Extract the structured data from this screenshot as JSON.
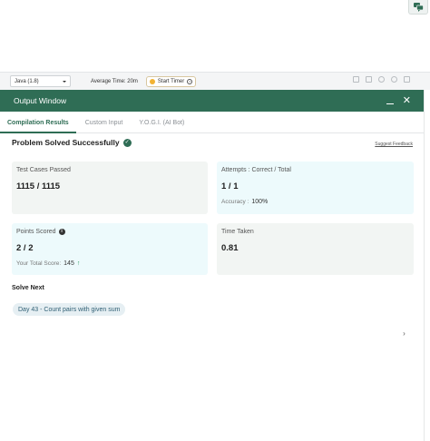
{
  "toolbar": {
    "language": "Java (1.8)",
    "avg_time": "Average Time: 20m",
    "start_timer": "Start Timer"
  },
  "output_window": {
    "title": "Output Window",
    "tabs": [
      {
        "label": "Compilation Results",
        "active": true
      },
      {
        "label": "Custom Input",
        "active": false
      },
      {
        "label": "Y.O.G.I. (AI Bot)",
        "active": false
      }
    ]
  },
  "result": {
    "status": "Problem Solved Successfully",
    "feedback_link": "Suggest Feedback"
  },
  "cards": {
    "test_cases": {
      "label": "Test Cases Passed",
      "value": "1115 / 1115"
    },
    "attempts": {
      "label": "Attempts : Correct / Total",
      "value": "1 / 1",
      "accuracy_label": "Accuracy :",
      "accuracy_value": "100%"
    },
    "points": {
      "label": "Points Scored",
      "value": "2 / 2",
      "total_label": "Your Total Score:",
      "total_value": "145"
    },
    "time": {
      "label": "Time Taken",
      "value": "0.81"
    }
  },
  "solve_next": {
    "heading": "Solve Next",
    "items": [
      "Day 43 - Count pairs with given sum"
    ]
  },
  "colors": {
    "header_green": "#2f6d55",
    "card_gray": "#f2f5f3",
    "card_blue": "#edfafc"
  },
  "icons": {
    "chat": "chat-bubbles-icon",
    "check": "check-circle-icon",
    "info": "info-icon",
    "up": "arrow-up-icon",
    "next": "chevron-right-icon"
  }
}
